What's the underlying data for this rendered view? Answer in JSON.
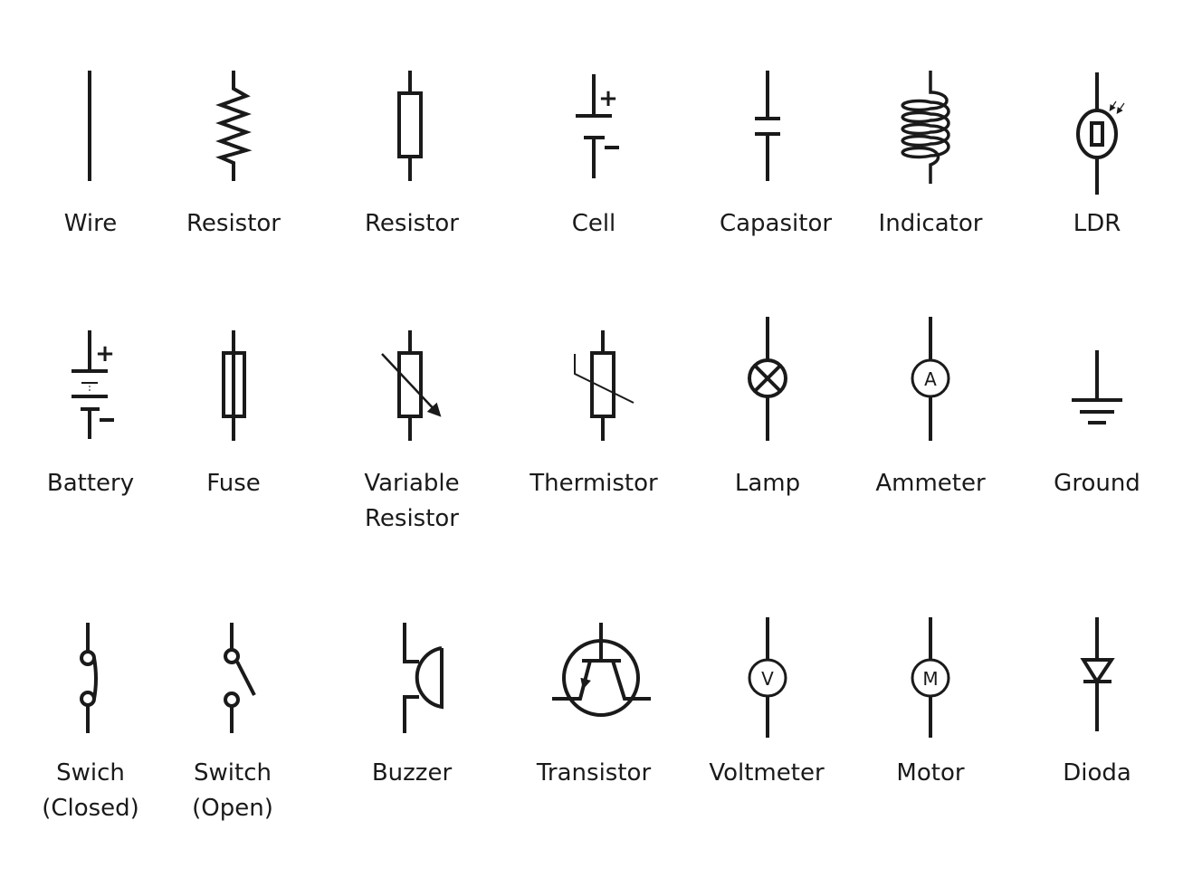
{
  "symbols": [
    {
      "id": "wire",
      "label": [
        "Wire"
      ]
    },
    {
      "id": "resistor-zigzag",
      "label": [
        "Resistor"
      ]
    },
    {
      "id": "resistor-box",
      "label": [
        "Resistor"
      ]
    },
    {
      "id": "cell",
      "label": [
        "Cell"
      ],
      "plus": "+",
      "minus": "−"
    },
    {
      "id": "capacitor",
      "label": [
        "Capasitor"
      ]
    },
    {
      "id": "indicator",
      "label": [
        "Indicator"
      ]
    },
    {
      "id": "ldr",
      "label": [
        "LDR"
      ]
    },
    {
      "id": "battery",
      "label": [
        "Battery"
      ],
      "plus": "+",
      "minus": "−"
    },
    {
      "id": "fuse",
      "label": [
        "Fuse"
      ]
    },
    {
      "id": "variable-resistor",
      "label": [
        "Variable",
        "Resistor"
      ]
    },
    {
      "id": "thermistor",
      "label": [
        "Thermistor"
      ]
    },
    {
      "id": "lamp",
      "label": [
        "Lamp"
      ]
    },
    {
      "id": "ammeter",
      "label": [
        "Ammeter"
      ],
      "letter": "A"
    },
    {
      "id": "ground",
      "label": [
        "Ground"
      ]
    },
    {
      "id": "switch-closed",
      "label": [
        "Swich",
        "(Closed)"
      ]
    },
    {
      "id": "switch-open",
      "label": [
        "Switch",
        "(Open)"
      ]
    },
    {
      "id": "buzzer",
      "label": [
        "Buzzer"
      ]
    },
    {
      "id": "transistor",
      "label": [
        "Transistor"
      ]
    },
    {
      "id": "voltmeter",
      "label": [
        "Voltmeter"
      ],
      "letter": "V"
    },
    {
      "id": "motor",
      "label": [
        "Motor"
      ],
      "letter": "M"
    },
    {
      "id": "diode",
      "label": [
        "Dioda"
      ]
    }
  ],
  "colors": {
    "stroke": "#1a1a1a",
    "background": "#ffffff"
  }
}
